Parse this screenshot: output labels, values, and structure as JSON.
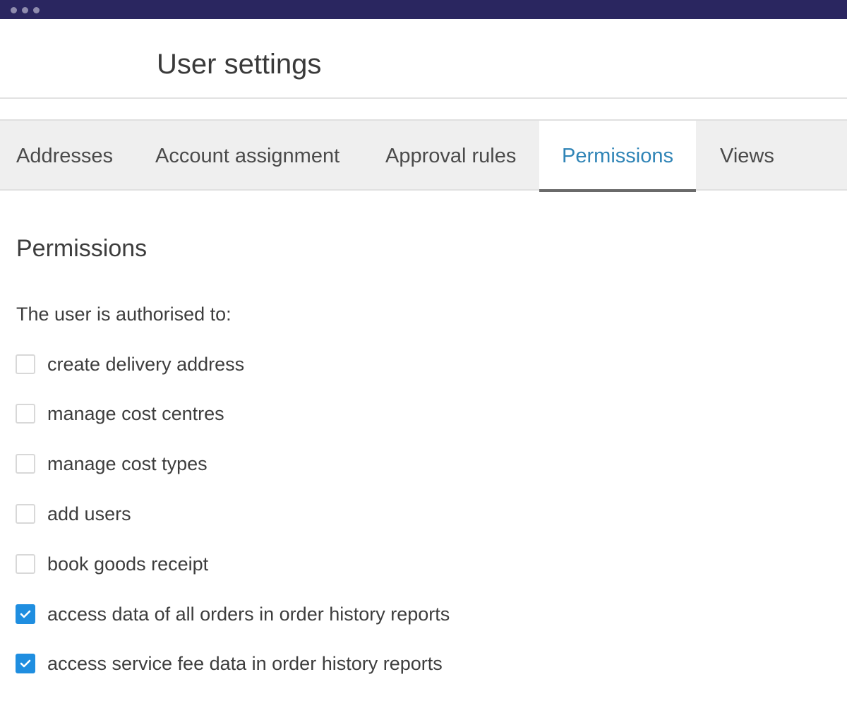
{
  "window": {
    "dots": [
      "dot",
      "dot",
      "dot"
    ]
  },
  "header": {
    "title": "User settings"
  },
  "tabs": [
    {
      "label": "Addresses",
      "active": false
    },
    {
      "label": "Account assignment",
      "active": false
    },
    {
      "label": "Approval rules",
      "active": false
    },
    {
      "label": "Permissions",
      "active": true
    },
    {
      "label": "Views",
      "active": false
    }
  ],
  "permissions": {
    "title": "Permissions",
    "intro": "The user is authorised to:",
    "items": [
      {
        "label": "create delivery address",
        "checked": false
      },
      {
        "label": "manage cost centres",
        "checked": false
      },
      {
        "label": "manage cost types",
        "checked": false
      },
      {
        "label": "add users",
        "checked": false
      },
      {
        "label": "book goods receipt",
        "checked": false
      },
      {
        "label": "access data of all orders in order history reports",
        "checked": true
      },
      {
        "label": "access service fee data in order history reports",
        "checked": true
      }
    ]
  },
  "colors": {
    "titlebar": "#2a2660",
    "accent": "#2f84b6",
    "checkbox_checked": "#1f8ee0"
  },
  "icons": {
    "checkmark": "checkmark-icon"
  }
}
